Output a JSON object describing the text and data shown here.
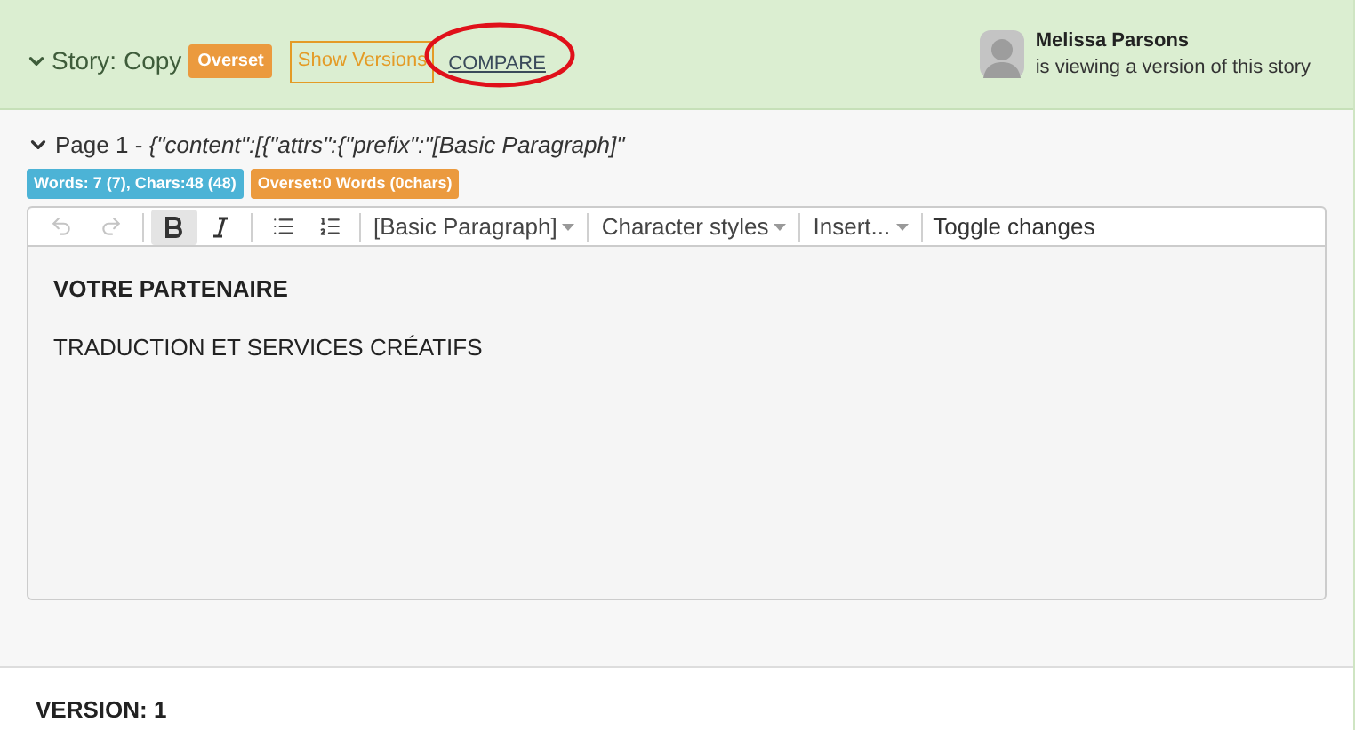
{
  "story": {
    "title": "Story: Copy",
    "expanded": true,
    "badge": "Overset",
    "show_versions": "Show Versions",
    "compare": {
      "label": "COMPARE",
      "circled": true
    }
  },
  "viewer": {
    "name": "Melissa Parsons",
    "status": "is viewing a version of this story"
  },
  "page": {
    "title": "Page 1 - ",
    "content_preview": "{\"content\":[{\"attrs\":{\"prefix\":\"[Basic Paragraph]\"",
    "expanded": true,
    "badges": [
      {
        "text": "Words: 7 (7), Chars:48 (48)",
        "color": "#4cb3d6"
      },
      {
        "text": "Overset:0 Words (0chars)",
        "color": "#eb9a3e"
      }
    ]
  },
  "toolbar": [
    {
      "kind": "undo",
      "disabled": true
    },
    {
      "kind": "redo",
      "disabled": true
    },
    {
      "kind": "separator"
    },
    {
      "kind": "bold",
      "active": true
    },
    {
      "kind": "italic",
      "active": false
    },
    {
      "kind": "separator"
    },
    {
      "kind": "bullet-list"
    },
    {
      "kind": "numbered-list"
    },
    {
      "kind": "separator"
    },
    {
      "kind": "dropdown",
      "label": "[Basic Paragraph]"
    },
    {
      "kind": "separator"
    },
    {
      "kind": "dropdown",
      "label": "Character styles"
    },
    {
      "kind": "separator"
    },
    {
      "kind": "dropdown",
      "label": "Insert..."
    },
    {
      "kind": "separator"
    },
    {
      "kind": "text",
      "label": "Toggle changes"
    }
  ],
  "paragraphs": [
    {
      "text": "VOTRE PARTENAIRE",
      "bold": true
    },
    {
      "text": "TRADUCTION ET SERVICES CRÉATIFS",
      "bold": false
    }
  ],
  "version": "VERSION: 1"
}
